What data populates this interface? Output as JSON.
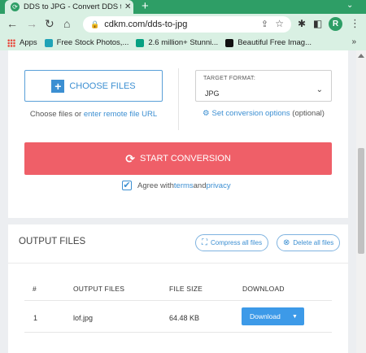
{
  "browser": {
    "tab": {
      "title": "DDS to JPG - Convert DDS to JPG",
      "close": "✕"
    },
    "new_tab": "+",
    "tab_menu": "⌄",
    "address": "cdkm.com/dds-to-jpg",
    "profile_initial": "R",
    "bookmarks": [
      {
        "label": "Apps",
        "color": "#4285f4"
      },
      {
        "label": "Free Stock Photos,...",
        "color": "#1fa3b7"
      },
      {
        "label": "2.6 million+ Stunni...",
        "color": "#05a081"
      },
      {
        "label": "Beautiful Free Imag...",
        "color": "#111111"
      }
    ],
    "bookmarks_more": "»"
  },
  "converter": {
    "choose_files_label": "CHOOSE FILES",
    "choose_text_prefix": "Choose files or ",
    "choose_text_link": "enter remote file URL",
    "target_format_label": "TARGET FORMAT:",
    "target_format_value": "JPG",
    "conversion_options_link": "Set conversion options",
    "conversion_options_suffix": " (optional)",
    "start_label": "START CONVERSION",
    "agree_prefix": "Agree with ",
    "agree_terms": "terms",
    "agree_and": " and ",
    "agree_privacy": "privacy"
  },
  "output": {
    "title": "OUTPUT FILES",
    "compress_label": "Compress all files",
    "delete_label": "Delete all files",
    "columns": [
      "#",
      "OUTPUT FILES",
      "FILE SIZE",
      "DOWNLOAD"
    ],
    "rows": [
      {
        "index": "1",
        "file": "lof.jpg",
        "size": "64.48 KB",
        "download_label": "Download"
      }
    ]
  },
  "colors": {
    "chrome_green": "#2e9e66",
    "accent_blue": "#3c8fd2",
    "start_red": "#ef5f68",
    "download_blue": "#3d9ae8"
  }
}
